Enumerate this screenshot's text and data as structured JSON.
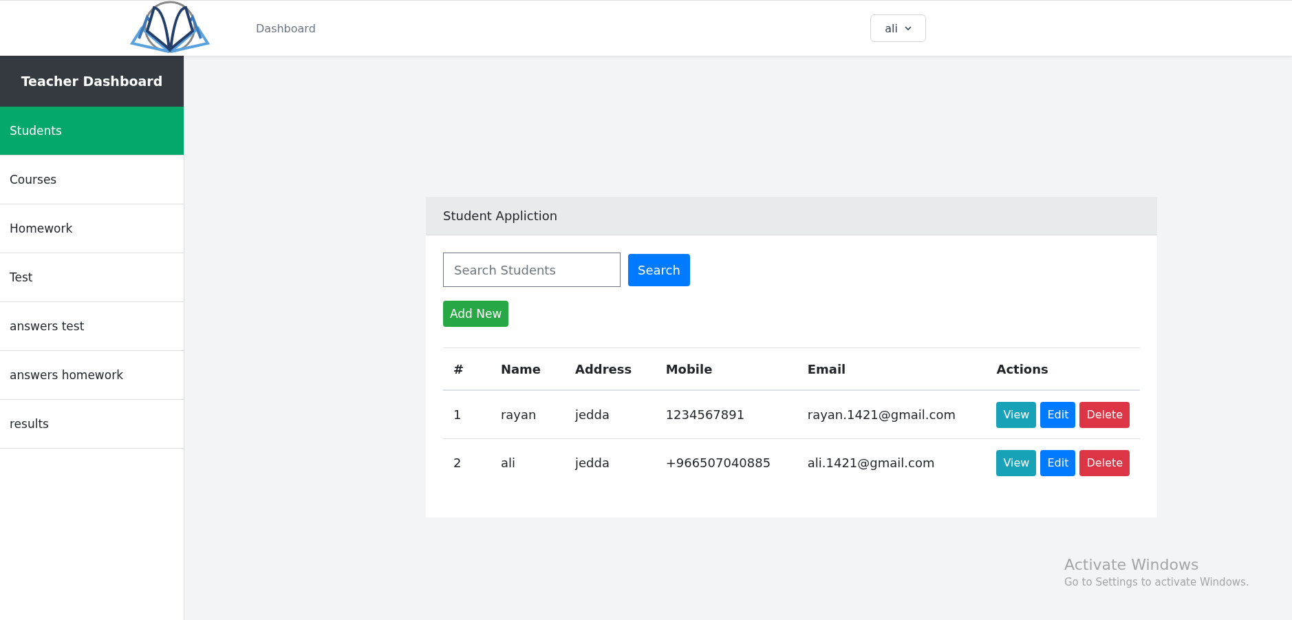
{
  "header": {
    "nav_link": "Dashboard",
    "user_menu": "ali"
  },
  "sidebar": {
    "title": "Teacher Dashboard",
    "items": [
      {
        "label": "Students",
        "selected": true
      },
      {
        "label": "Courses",
        "selected": false
      },
      {
        "label": "Homework",
        "selected": false
      },
      {
        "label": "Test",
        "selected": false
      },
      {
        "label": "answers test",
        "selected": false
      },
      {
        "label": "answers homework",
        "selected": false
      },
      {
        "label": "results",
        "selected": false
      }
    ]
  },
  "card": {
    "title": "Student Appliction",
    "search": {
      "placeholder": "Search Students",
      "button": "Search"
    },
    "add_button": "Add New",
    "table": {
      "columns": [
        "#",
        "Name",
        "Address",
        "Mobile",
        "Email",
        "Actions"
      ],
      "rows": [
        {
          "cells": [
            "1",
            "rayan",
            "jedda",
            "1234567891",
            "rayan.1421@gmail.com"
          ],
          "actions": [
            {
              "kind": "view",
              "label": "View"
            },
            {
              "kind": "edit",
              "label": "Edit"
            },
            {
              "kind": "delete",
              "label": "Delete"
            }
          ]
        },
        {
          "cells": [
            "2",
            "ali",
            "jedda",
            "+966507040885",
            "ali.1421@gmail.com"
          ],
          "actions": [
            {
              "kind": "view",
              "label": "View"
            },
            {
              "kind": "edit",
              "label": "Edit"
            },
            {
              "kind": "delete",
              "label": "Delete"
            }
          ]
        }
      ]
    }
  },
  "os_notice": {
    "title": "Activate Windows",
    "text": "Go to Settings to activate Windows."
  }
}
